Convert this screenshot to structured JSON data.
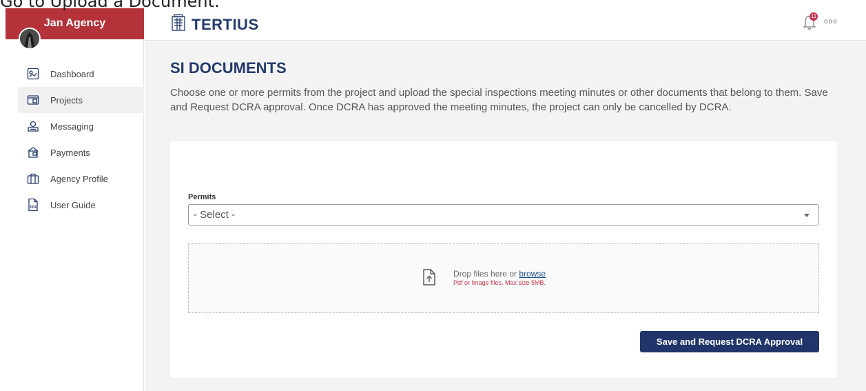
{
  "instruction": "Go to Upload a Document.",
  "sidebar": {
    "agency_name": "Jan Agency",
    "items": [
      {
        "label": "Dashboard",
        "icon": "dashboard-icon",
        "active": false
      },
      {
        "label": "Projects",
        "icon": "projects-icon",
        "active": true
      },
      {
        "label": "Messaging",
        "icon": "messaging-icon",
        "active": false
      },
      {
        "label": "Payments",
        "icon": "payments-icon",
        "active": false
      },
      {
        "label": "Agency Profile",
        "icon": "briefcase-icon",
        "active": false
      },
      {
        "label": "User Guide",
        "icon": "pdf-icon",
        "active": false
      }
    ]
  },
  "header": {
    "logo_text": "TERTIUS",
    "notification_count": "11",
    "more_label": "ooo"
  },
  "main": {
    "title": "SI DOCUMENTS",
    "description": "Choose one or more permits from the project and upload the special inspections meeting minutes or other documents that belong to them. Save and Request DCRA approval. Once DCRA has approved the meeting minutes, the project can only be cancelled by DCRA.",
    "permits_label": "Permits",
    "permits_select_value": "- Select -",
    "dropzone": {
      "text": "Drop files here or ",
      "browse_label": "browse",
      "hint": "Pdf or Image files. Max size 5MB."
    },
    "save_button_label": "Save and Request DCRA Approval"
  },
  "colors": {
    "brand_red": "#b4333a",
    "navy": "#243a6b",
    "button_navy": "#21356a",
    "hint_red": "#c2334a"
  }
}
